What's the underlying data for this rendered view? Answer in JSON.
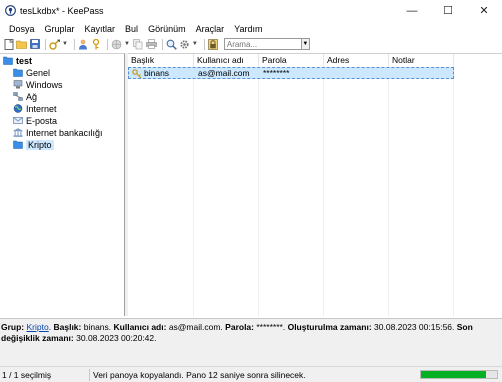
{
  "window": {
    "title": "tesLkdbx* - KeePass",
    "controls": {
      "minimize": "—",
      "maximize": "☐",
      "close": "✕"
    }
  },
  "menu": [
    "Dosya",
    "Gruplar",
    "Kayıtlar",
    "Bul",
    "Görünüm",
    "Araçlar",
    "Yardım"
  ],
  "toolbar": {
    "search_placeholder": "Arama...",
    "icons": [
      "new-icon",
      "open-icon",
      "save-icon",
      "add-entry-icon",
      "user-key-icon",
      "key-icon",
      "globe-icon",
      "copy-icon",
      "print-icon",
      "find-icon",
      "settings-icon",
      "lock-icon"
    ]
  },
  "tree": {
    "root": "test",
    "groups": [
      "Genel",
      "Windows",
      "Ağ",
      "Internet",
      "E-posta",
      "Internet bankacılığı",
      "Kripto"
    ],
    "selected": "Kripto"
  },
  "entries": {
    "columns": [
      "Başlık",
      "Kullanıcı adı",
      "Parola",
      "Adres",
      "Notlar"
    ],
    "rows": [
      {
        "title": "binans",
        "username": "as@mail.com",
        "password": "********",
        "url": "",
        "notes": ""
      }
    ]
  },
  "details": {
    "group_label": "Grup:",
    "group_value": "Kripto",
    "title_label": "Başlık:",
    "title_value": "binans.",
    "user_label": "Kullanıcı adı:",
    "user_value": "as@mail.com.",
    "pass_label": "Parola:",
    "pass_value": "********.",
    "created_label": "Oluşturulma zamanı:",
    "created_value": "30.08.2023 00:15:56.",
    "modified_label": "Son değişiklik zamanı:",
    "modified_value": "30.08.2023 00:20:42."
  },
  "status": {
    "selection": "1 / 1 seçilmiş",
    "message": "Veri panoya kopyalandı. Pano 12 saniye sonra silinecek.",
    "progress": 0.85,
    "progress_color": "#06b025"
  },
  "colors": {
    "selection": "#cce8ff",
    "folder": "#3a8ee6",
    "link": "#0645ad"
  }
}
